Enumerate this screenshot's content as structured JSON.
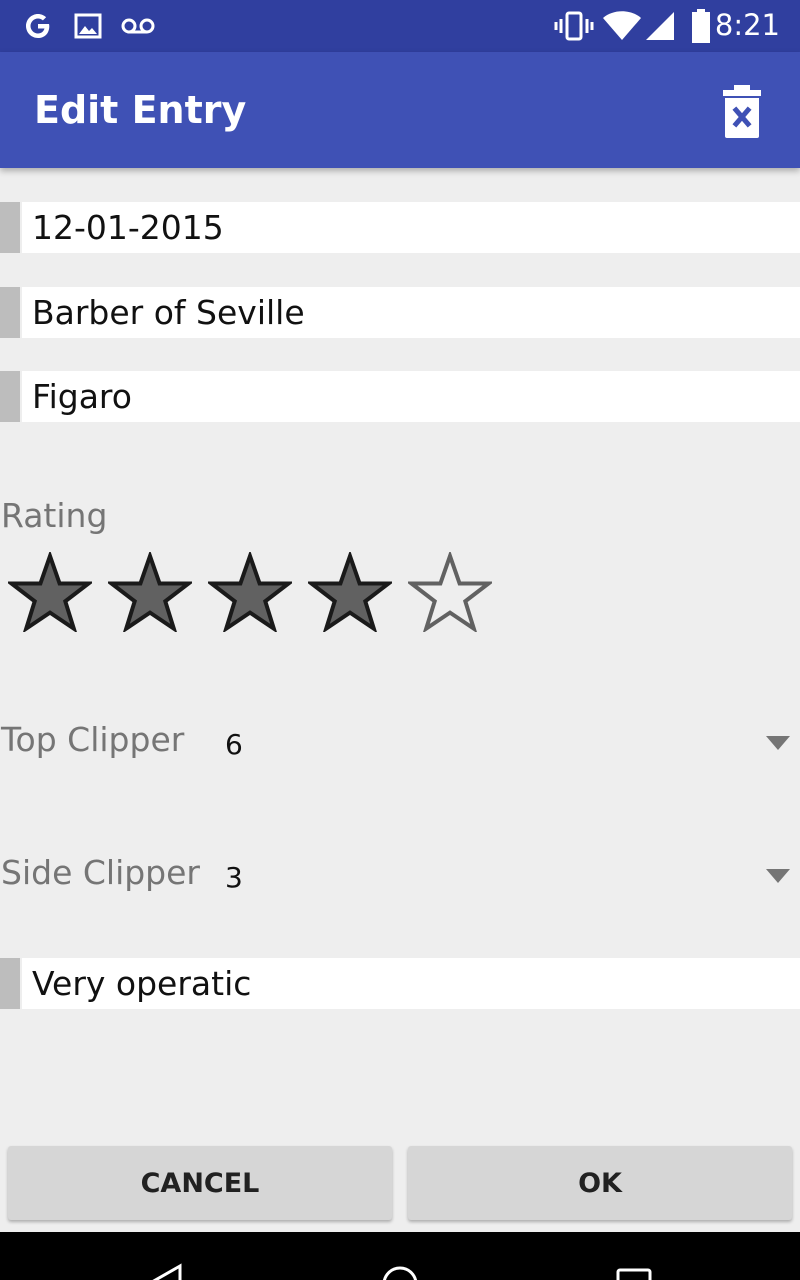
{
  "status_bar": {
    "time": "8:21",
    "left_icons": [
      "google-icon",
      "image-icon",
      "voicemail-icon"
    ],
    "right_icons": [
      "vibrate-icon",
      "wifi-icon",
      "signal-icon",
      "battery-icon"
    ]
  },
  "app_bar": {
    "title": "Edit Entry",
    "action_icon": "delete-icon",
    "color": "#3f51b5",
    "status_color": "#303f9f"
  },
  "form": {
    "date": "12-01-2015",
    "title": "Barber of Seville",
    "character": "Figaro",
    "rating_label": "Rating",
    "rating": {
      "value": 4,
      "max": 5
    },
    "top_clipper": {
      "label": "Top Clipper",
      "value": "6"
    },
    "side_clipper": {
      "label": "Side Clipper",
      "value": "3"
    },
    "notes": "Very operatic"
  },
  "buttons": {
    "cancel": "CANCEL",
    "ok": "OK"
  },
  "nav_bar": {
    "icons": [
      "back-icon",
      "home-icon",
      "recents-icon"
    ]
  }
}
